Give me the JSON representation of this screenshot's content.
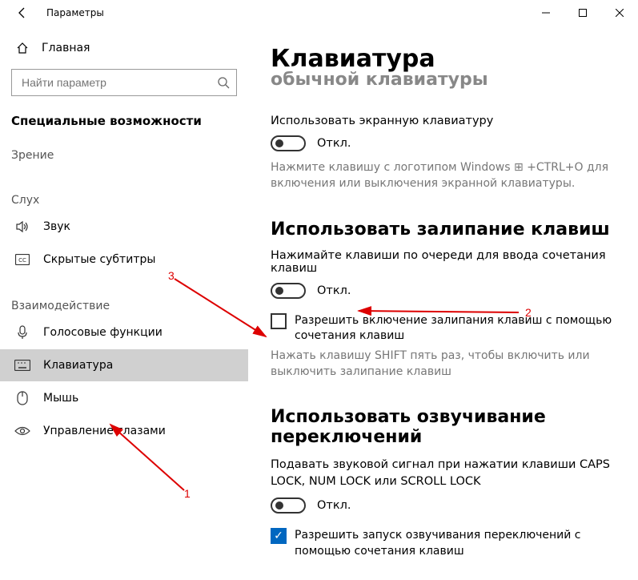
{
  "window": {
    "title": "Параметры"
  },
  "sidebar": {
    "home": "Главная",
    "search_placeholder": "Найти параметр",
    "section": "Специальные возможности",
    "group_vision": "Зрение",
    "group_hearing": "Слух",
    "group_interaction": "Взаимодействие",
    "items": {
      "sound": "Звук",
      "cc": "Скрытые субтитры",
      "voice": "Голосовые функции",
      "keyboard": "Клавиатура",
      "mouse": "Мышь",
      "eye": "Управление глазами"
    }
  },
  "content": {
    "title": "Клавиатура",
    "prev_heading": "Использовать устройство без обычной клавиатуры",
    "osk_label": "Использовать экранную клавиатуру",
    "off": "Откл.",
    "osk_hint": "Нажмите клавишу с логотипом Windows ⊞ +CTRL+O для включения или выключения экранной клавиатуры.",
    "sticky_heading": "Использовать залипание клавиш",
    "sticky_label": "Нажимайте клавиши по очереди для ввода сочетания клавиш",
    "sticky_chk": "Разрешить включение залипания клавиш с помощью сочетания клавиш",
    "sticky_hint": "Нажать клавишу SHIFT пять раз, чтобы включить или выключить залипание клавиш",
    "togglekeys_heading": "Использовать озвучивание переключений",
    "togglekeys_label": "Подавать звуковой сигнал при нажатии клавиши CAPS LOCK, NUM LOCK или SCROLL LOCK",
    "togglekeys_chk": "Разрешить запуск озвучивания переключений с помощью сочетания клавиш"
  },
  "annotations": {
    "n1": "1",
    "n2": "2",
    "n3": "3"
  }
}
